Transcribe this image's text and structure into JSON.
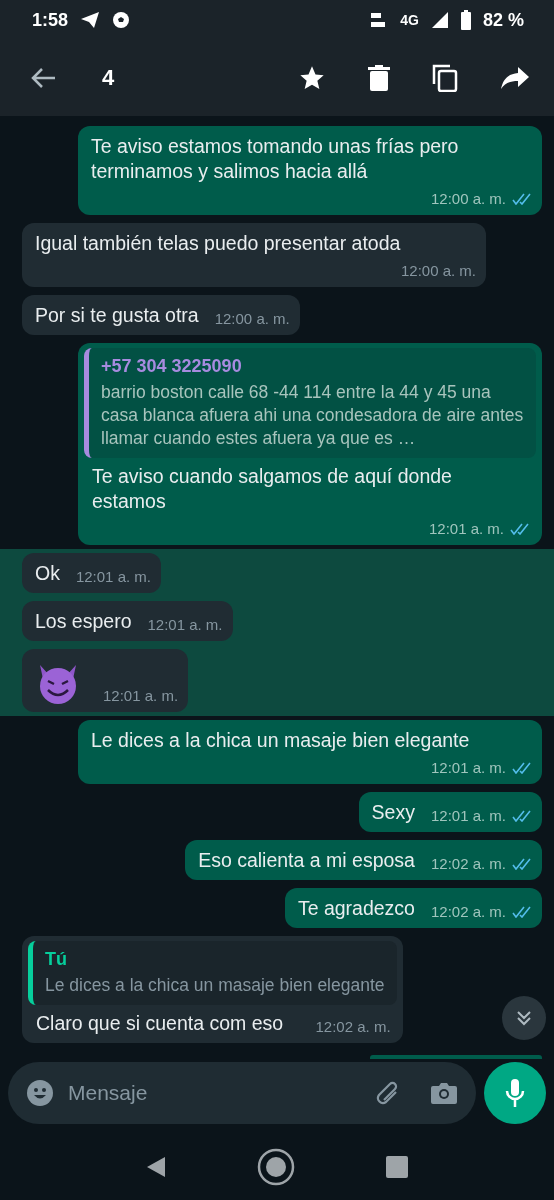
{
  "status_bar": {
    "time": "1:58",
    "network": "4G",
    "battery": "82 %"
  },
  "toolbar": {
    "selected_count": "4"
  },
  "messages": [
    {
      "kind": "text",
      "outgoing": true,
      "selected": false,
      "text": "Te aviso estamos tomando unas frías pero terminamos y salimos hacia allá",
      "time": "12:00 a. m.",
      "read": true
    },
    {
      "kind": "text",
      "outgoing": false,
      "selected": false,
      "text": "Igual también telas puedo presentar atoda",
      "time": "12:00 a. m."
    },
    {
      "kind": "text",
      "outgoing": false,
      "selected": false,
      "text": "Por si te gusta otra",
      "time": "12:00 a. m."
    },
    {
      "kind": "quote",
      "outgoing": true,
      "selected": false,
      "quote_author": "+57 304 3225090",
      "quote_text": "barrio boston calle 68 -44 114 entre la 44 y 45 una casa blanca afuera ahi una condesadora de aire antes llamar cuando estes afuera ya que es …",
      "text": "Te aviso cuando salgamos de aquí donde estamos",
      "time": "12:01 a. m.",
      "read": true
    },
    {
      "kind": "text",
      "outgoing": false,
      "selected": true,
      "text": "Ok",
      "time": "12:01 a. m."
    },
    {
      "kind": "text",
      "outgoing": false,
      "selected": true,
      "text": "Los espero",
      "time": "12:01 a. m."
    },
    {
      "kind": "emoji",
      "outgoing": false,
      "selected": true,
      "time": "12:01 a. m."
    },
    {
      "kind": "text",
      "outgoing": true,
      "selected": false,
      "text": "Le dices a la chica un masaje bien elegante",
      "time": "12:01 a. m.",
      "read": true
    },
    {
      "kind": "text",
      "outgoing": true,
      "selected": false,
      "text": "Sexy",
      "time": "12:01 a. m.",
      "read": true
    },
    {
      "kind": "text",
      "outgoing": true,
      "selected": false,
      "text": "Eso calienta a mi esposa",
      "time": "12:02 a. m.",
      "read": true
    },
    {
      "kind": "text",
      "outgoing": true,
      "selected": false,
      "text": "Te agradezco",
      "time": "12:02 a. m.",
      "read": true
    },
    {
      "kind": "quote",
      "outgoing": false,
      "selected": false,
      "quote_author": "Tú",
      "quote_text": "Le dices a la chica un masaje bien elegante",
      "text": "Claro que si cuenta com eso",
      "time": "12:02 a. m."
    }
  ],
  "composer": {
    "placeholder": "Mensaje"
  }
}
